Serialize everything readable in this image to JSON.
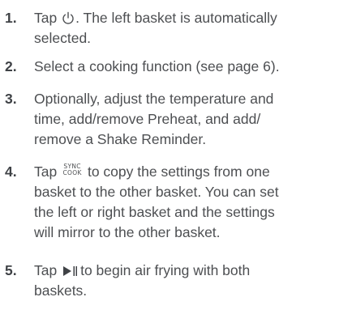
{
  "steps": [
    {
      "number": "1.",
      "lines": [
        "Tap",
        ". The left basket is automatically",
        "selected."
      ]
    },
    {
      "number": "2.",
      "lines": [
        "Select a cooking function (see page 6)."
      ]
    },
    {
      "number": "3.",
      "lines": [
        "Optionally, adjust the temperature and",
        "time, add/remove Preheat, and add/",
        "remove a Shake Reminder."
      ]
    },
    {
      "number": "4.",
      "lines": [
        "Tap",
        "to copy the settings from one",
        "basket to the other basket. You can set",
        "the left or right basket and the settings",
        "will mirror to the other basket."
      ]
    },
    {
      "number": "5.",
      "lines": [
        "Tap",
        "to begin air frying with both",
        "baskets."
      ]
    }
  ],
  "icons": {
    "power": "power-icon",
    "sync_cook": {
      "top": "SYNC",
      "bottom": "COOK"
    },
    "play_pause": "play-pause-icon"
  }
}
